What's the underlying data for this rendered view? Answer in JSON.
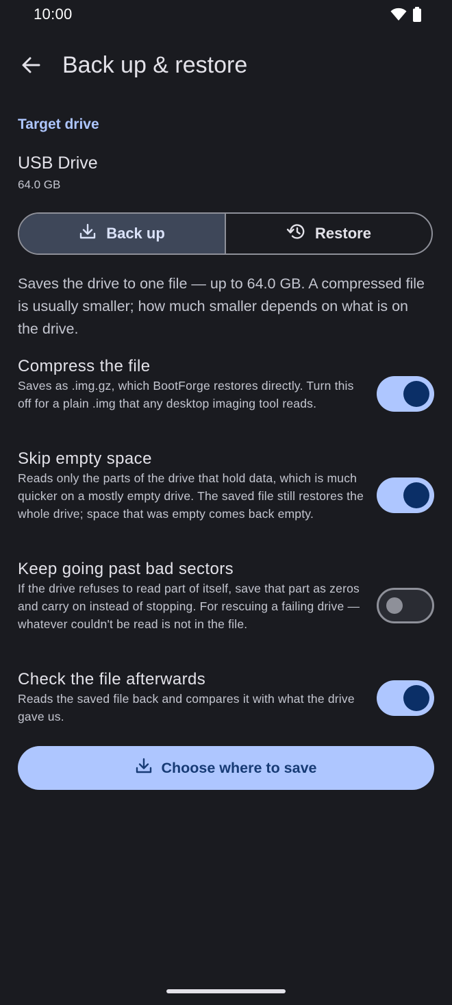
{
  "status_bar": {
    "time": "10:00",
    "icons": [
      "wifi-icon",
      "battery-icon"
    ]
  },
  "app_bar": {
    "title": "Back up & restore",
    "back_icon": "arrow-back-icon"
  },
  "target_drive": {
    "section_label": "Target drive",
    "name": "USB Drive",
    "size": "64.0 GB"
  },
  "mode_toggle": {
    "options": [
      {
        "label": "Back up",
        "icon": "download-icon",
        "selected": true
      },
      {
        "label": "Restore",
        "icon": "history-icon",
        "selected": false
      }
    ]
  },
  "description": "Saves the drive to one file — up to 64.0 GB. A compressed file is usually smaller; how much smaller depends on what is on the drive.",
  "settings": [
    {
      "title": "Compress the file",
      "description": "Saves as .img.gz, which BootForge restores directly. Turn this off for a plain .img that any desktop imaging tool reads.",
      "enabled": true
    },
    {
      "title": "Skip empty space",
      "description": "Reads only the parts of the drive that hold data, which is much quicker on a mostly empty drive. The saved file still restores the whole drive; space that was empty comes back empty.",
      "enabled": true
    },
    {
      "title": "Keep going past bad sectors",
      "description": "If the drive refuses to read part of itself, save that part as zeros and carry on instead of stopping. For rescuing a failing drive — whatever couldn't be read is not in the file.",
      "enabled": false
    },
    {
      "title": "Check the file afterwards",
      "description": "Reads the saved file back and compares it with what the drive gave us.",
      "enabled": true
    }
  ],
  "primary_action": {
    "label": "Choose where to save",
    "icon": "download-icon"
  },
  "colors": {
    "background": "#1a1b20",
    "accent": "#aec6ff",
    "on_accent": "#173b75",
    "switch_thumb_on": "#0b2f67",
    "selected_segment": "#3e4759"
  }
}
